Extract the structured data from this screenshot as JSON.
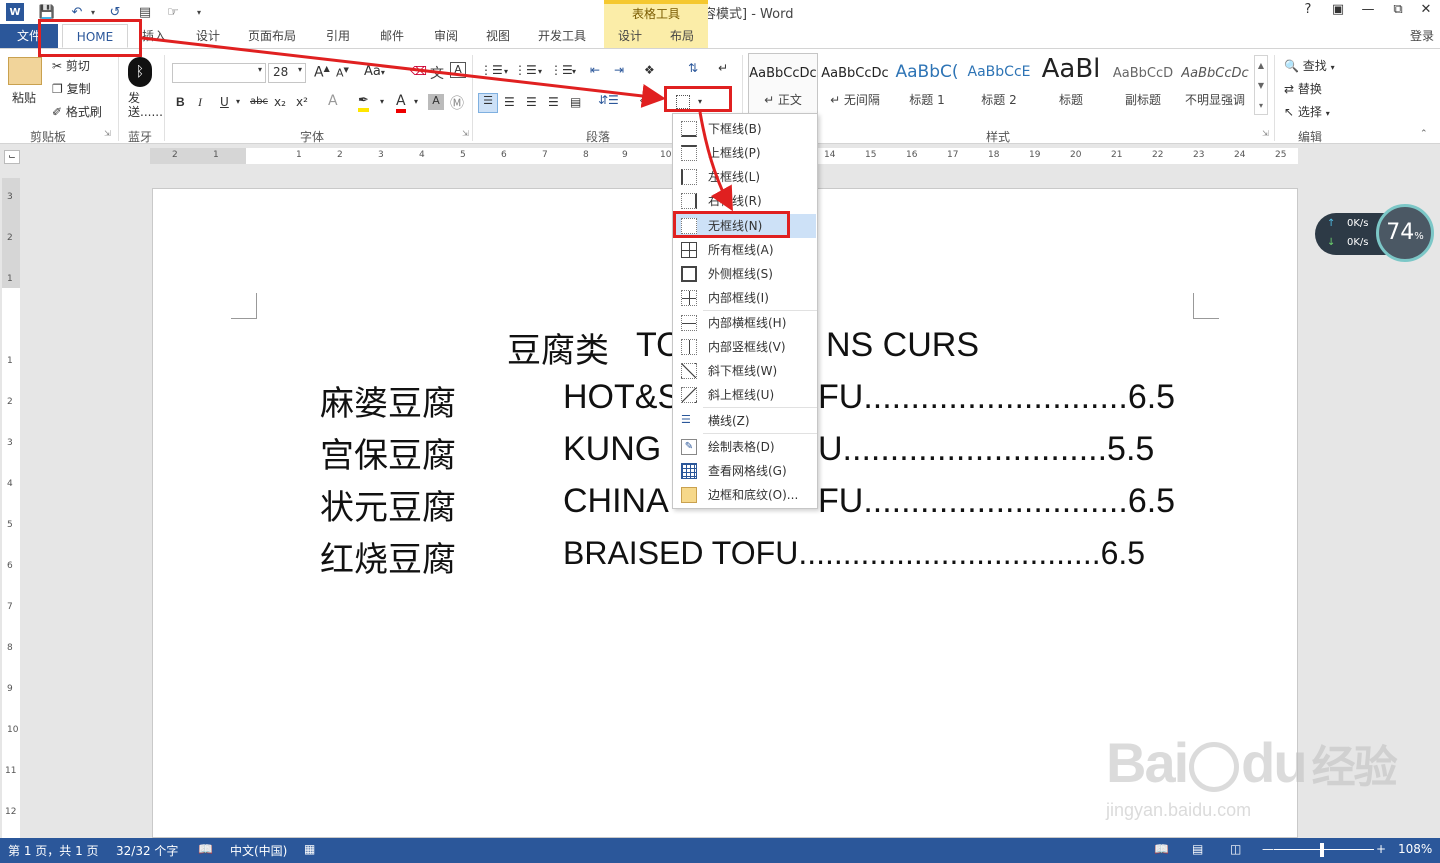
{
  "window": {
    "title": "文档1 [兼容模式] - Word",
    "context_header": "表格工具",
    "help": "?",
    "login": "登录"
  },
  "qat": [
    "save-icon",
    "undo-icon",
    "redo-icon",
    "repeat-icon",
    "print-preview-icon",
    "customize-qat-icon"
  ],
  "tabs": [
    {
      "label": "文件"
    },
    {
      "label": "HOME"
    },
    {
      "label": "插入"
    },
    {
      "label": "设计"
    },
    {
      "label": "页面布局"
    },
    {
      "label": "引用"
    },
    {
      "label": "邮件"
    },
    {
      "label": "审阅"
    },
    {
      "label": "视图"
    },
    {
      "label": "开发工具"
    },
    {
      "label": "设计"
    },
    {
      "label": "布局"
    }
  ],
  "ribbon": {
    "clipboard": {
      "paste": "粘贴",
      "cut": "剪切",
      "copy": "复制",
      "format_painter": "格式刷",
      "label": "剪贴板"
    },
    "bluetooth": {
      "send": "发送......",
      "label": "蓝牙"
    },
    "font": {
      "size": "28",
      "label": "字体",
      "bold": "B",
      "italic": "I",
      "underline": "U",
      "strike": "abc",
      "sub": "x₂",
      "sup": "x²",
      "grow": "A",
      "shrink": "A",
      "case": "Aa"
    },
    "paragraph": {
      "label": "段落"
    },
    "styles": {
      "label": "样式",
      "items": [
        {
          "preview": "AaBbCcDc",
          "name": "↵ 正文"
        },
        {
          "preview": "AaBbCcDc",
          "name": "↵ 无间隔"
        },
        {
          "preview": "AaBbC(",
          "name": "标题 1"
        },
        {
          "preview": "AaBbCcE",
          "name": "标题 2"
        },
        {
          "preview": "AaBl",
          "name": "标题"
        },
        {
          "preview": "AaBbCcD",
          "name": "副标题"
        },
        {
          "preview": "AaBbCcDc",
          "name": "不明显强调"
        }
      ]
    },
    "editing": {
      "find": "查找",
      "replace": "替换",
      "select": "选择",
      "label": "编辑"
    }
  },
  "ruler": {
    "h_ticks": [
      "2",
      "1",
      "1",
      "2",
      "3",
      "4",
      "5",
      "6",
      "7",
      "8",
      "9",
      "10",
      "14",
      "15",
      "16",
      "17",
      "18",
      "19",
      "20",
      "21",
      "22",
      "23",
      "24",
      "25"
    ],
    "v_ticks": [
      "3",
      "2",
      "1",
      "1",
      "2",
      "3",
      "4",
      "5",
      "6",
      "7",
      "8",
      "9",
      "10",
      "11",
      "12"
    ]
  },
  "document": {
    "title_cn": "豆腐类",
    "title_en": "TO",
    "title_en_tail": "NS CURS",
    "rows": [
      {
        "cn": "麻婆豆腐",
        "en": "HOT&S",
        "tail": "FU............................6.5"
      },
      {
        "cn": "宫保豆腐",
        "en": "KUNG",
        "tail": "U............................5.5"
      },
      {
        "cn": "状元豆腐",
        "en": "CHINA",
        "tail": "FU............................6.5"
      },
      {
        "cn": "红烧豆腐",
        "en": "BRAISED TOFU..................................6.5",
        "tail": ""
      }
    ]
  },
  "border_menu": {
    "items": [
      {
        "label": "下框线(B)"
      },
      {
        "label": "上框线(P)"
      },
      {
        "label": "左框线(L)"
      },
      {
        "label": "右框线(R)"
      },
      {
        "label": "无框线(N)"
      },
      {
        "label": "所有框线(A)"
      },
      {
        "label": "外侧框线(S)"
      },
      {
        "label": "内部框线(I)"
      },
      {
        "label": "内部横框线(H)"
      },
      {
        "label": "内部竖框线(V)"
      },
      {
        "label": "斜下框线(W)"
      },
      {
        "label": "斜上框线(U)"
      },
      {
        "label": "横线(Z)"
      },
      {
        "label": "绘制表格(D)"
      },
      {
        "label": "查看网格线(G)"
      },
      {
        "label": "边框和底纹(O)..."
      }
    ],
    "highlighted": "无框线(N)"
  },
  "net_widget": {
    "up": "0K/s",
    "down": "0K/s",
    "percent": "74",
    "unit": "%"
  },
  "status": {
    "page": "第 1 页，共 1 页",
    "words": "32/32 个字",
    "lang": "中文(中国)",
    "zoom": "108%"
  },
  "watermark": {
    "brand": "Bai",
    "brand2": "du",
    "cn": "经验",
    "url": "jingyan.baidu.com"
  },
  "colors": {
    "accent": "#2b579a",
    "annotation": "#e02020",
    "highlight": "#cde1f7",
    "context_tab": "#fbeda8"
  }
}
